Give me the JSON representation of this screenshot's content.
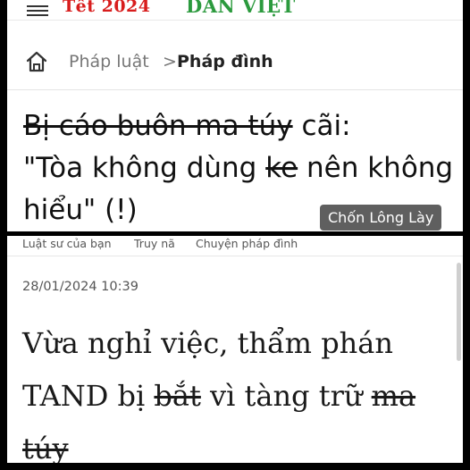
{
  "top": {
    "header": {
      "tet_logo": "Tết 2024",
      "site_logo": "DÂN VIỆT"
    },
    "breadcrumb": {
      "parent": "Pháp luật",
      "separator": ">",
      "current": "Pháp đình"
    },
    "headline": {
      "struck": "Bị cáo buôn ma túy",
      "part1": " cãi:",
      "part2": "\"Tòa không dùng ",
      "struck2": "ke",
      "part3": " nên không hiểu\" (!)"
    },
    "watermark": "Chốn Lông Lày"
  },
  "bottom": {
    "subnav": [
      "Luật sư của bạn",
      "Truy nã",
      "Chuyện pháp đình"
    ],
    "timestamp": "28/01/2024 10:39",
    "title": {
      "part1": "Vừa nghỉ việc, thẩm phán TAND bị ",
      "struck1": "bắt",
      "part2": " vì tàng trữ ",
      "struck2": "ma túy"
    }
  },
  "colors": {
    "accent_red": "#d81d1d",
    "accent_green": "#2c9a3e",
    "watermark_bg": "#5f5f5f"
  },
  "icons": [
    "menu-icon",
    "home-icon"
  ]
}
